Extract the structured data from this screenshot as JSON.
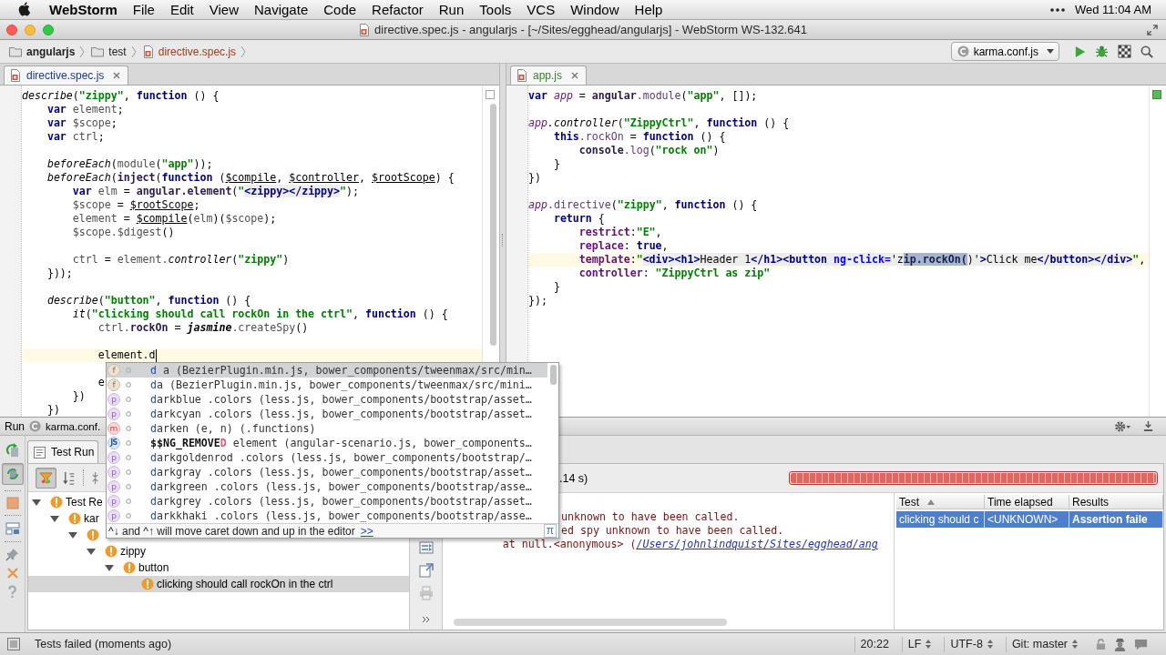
{
  "menubar": {
    "app": "WebStorm",
    "menus": [
      "File",
      "Edit",
      "View",
      "Navigate",
      "Code",
      "Refactor",
      "Run",
      "Tools",
      "VCS",
      "Window",
      "Help"
    ],
    "clock": "Wed 11:04 AM"
  },
  "window": {
    "title": "directive.spec.js - angularjs - [~/Sites/egghead/angularjs] - WebStorm WS-132.641"
  },
  "navbar": {
    "crumbs": [
      {
        "kind": "project",
        "label": "angularjs"
      },
      {
        "kind": "folder",
        "label": "test"
      },
      {
        "kind": "file",
        "label": "directive.spec.js",
        "unversioned": true
      }
    ],
    "run_config": "karma.conf.js"
  },
  "editors": [
    {
      "tab": {
        "label": "directive.spec.js",
        "modified": true,
        "added": false,
        "selected": true
      },
      "inspection_passed": false,
      "lines": [
        {
          "current": false,
          "tokens": [
            {
              "text": "describe",
              "kind": "call"
            },
            {
              "text": "(",
              "kind": "plain"
            },
            {
              "text": "\"zippy\"",
              "kind": "string"
            },
            {
              "text": ", ",
              "kind": "plain"
            },
            {
              "text": "function",
              "kind": "keyword"
            },
            {
              "text": " () {",
              "kind": "plain"
            }
          ],
          "children": [
            {
              "current": false,
              "tokens": [
                {
                  "text": "var",
                  "kind": "keyword"
                },
                {
                  "text": " element",
                  "kind": "local"
                },
                {
                  "text": ";",
                  "kind": "plain"
                }
              ]
            },
            {
              "current": false,
              "tokens": [
                {
                  "text": "var",
                  "kind": "keyword"
                },
                {
                  "text": " $scope",
                  "kind": "local"
                },
                {
                  "text": ";",
                  "kind": "plain"
                }
              ]
            },
            {
              "current": false,
              "tokens": [
                {
                  "text": "var",
                  "kind": "keyword"
                },
                {
                  "text": " ctrl",
                  "kind": "local"
                },
                {
                  "text": ";",
                  "kind": "plain"
                }
              ]
            },
            {
              "current": false
            },
            {
              "current": false,
              "tokens": [
                {
                  "text": "beforeEach",
                  "kind": "call"
                },
                {
                  "text": "(",
                  "kind": "plain"
                },
                {
                  "text": "module",
                  "kind": "local"
                },
                {
                  "text": "(",
                  "kind": "plain"
                },
                {
                  "text": "\"app\"",
                  "kind": "string"
                },
                {
                  "text": "));",
                  "kind": "plain"
                }
              ]
            },
            {
              "current": false,
              "tokens": [
                {
                  "text": "beforeEach",
                  "kind": "call"
                },
                {
                  "text": "(",
                  "kind": "plain"
                },
                {
                  "text": "inject",
                  "kind": "global"
                },
                {
                  "text": "(",
                  "kind": "plain"
                },
                {
                  "text": "function",
                  "kind": "keyword"
                },
                {
                  "text": " (",
                  "kind": "plain"
                },
                {
                  "text": "$compile",
                  "kind": "param"
                },
                {
                  "text": ", ",
                  "kind": "plain"
                },
                {
                  "text": "$controller",
                  "kind": "param"
                },
                {
                  "text": ", ",
                  "kind": "plain"
                },
                {
                  "text": "$rootScope",
                  "kind": "param"
                },
                {
                  "text": ") {",
                  "kind": "plain"
                }
              ],
              "children": [
                {
                  "current": false,
                  "tokens": [
                    {
                      "text": "var",
                      "kind": "keyword"
                    },
                    {
                      "text": " elm",
                      "kind": "local"
                    },
                    {
                      "text": " = ",
                      "kind": "plain"
                    },
                    {
                      "text": "angular.element",
                      "kind": "global"
                    },
                    {
                      "text": "(",
                      "kind": "plain"
                    },
                    {
                      "text": "\"",
                      "kind": "string"
                    },
                    {
                      "text": "<zippy></zippy>",
                      "kind": "tag"
                    },
                    {
                      "text": "\"",
                      "kind": "string"
                    },
                    {
                      "text": ");",
                      "kind": "plain"
                    }
                  ]
                },
                {
                  "current": false,
                  "tokens": [
                    {
                      "text": "$scope",
                      "kind": "local"
                    },
                    {
                      "text": " = ",
                      "kind": "plain"
                    },
                    {
                      "text": "$rootScope",
                      "kind": "param"
                    },
                    {
                      "text": ";",
                      "kind": "plain"
                    }
                  ]
                },
                {
                  "current": false,
                  "tokens": [
                    {
                      "text": "element",
                      "kind": "local"
                    },
                    {
                      "text": " = ",
                      "kind": "plain"
                    },
                    {
                      "text": "$compile",
                      "kind": "param"
                    },
                    {
                      "text": "(",
                      "kind": "plain"
                    },
                    {
                      "text": "elm",
                      "kind": "local"
                    },
                    {
                      "text": ")(",
                      "kind": "plain"
                    },
                    {
                      "text": "$scope",
                      "kind": "local"
                    },
                    {
                      "text": ");",
                      "kind": "plain"
                    }
                  ]
                },
                {
                  "current": false,
                  "tokens": [
                    {
                      "text": "$scope.$digest",
                      "kind": "local"
                    },
                    {
                      "text": "()",
                      "kind": "plain"
                    }
                  ]
                },
                {
                  "current": false
                },
                {
                  "current": false,
                  "tokens": [
                    {
                      "text": "ctrl",
                      "kind": "local"
                    },
                    {
                      "text": " = ",
                      "kind": "plain"
                    },
                    {
                      "text": "element.",
                      "kind": "local"
                    },
                    {
                      "text": "controller",
                      "kind": "call"
                    },
                    {
                      "text": "(",
                      "kind": "plain"
                    },
                    {
                      "text": "\"zippy\"",
                      "kind": "string"
                    },
                    {
                      "text": ")",
                      "kind": "plain"
                    }
                  ]
                }
              ]
            },
            {
              "current": false,
              "tokens": [
                {
                  "text": "}));",
                  "kind": "plain"
                }
              ]
            },
            {
              "current": false
            },
            {
              "current": false,
              "tokens": [
                {
                  "text": "describe",
                  "kind": "call"
                },
                {
                  "text": "(",
                  "kind": "plain"
                },
                {
                  "text": "\"button\"",
                  "kind": "string"
                },
                {
                  "text": ", ",
                  "kind": "plain"
                },
                {
                  "text": "function",
                  "kind": "keyword"
                },
                {
                  "text": " () {",
                  "kind": "plain"
                }
              ],
              "children": [
                {
                  "current": false,
                  "tokens": [
                    {
                      "text": "it",
                      "kind": "call"
                    },
                    {
                      "text": "(",
                      "kind": "plain"
                    },
                    {
                      "text": "\"clicking should call rockOn in the ctrl\"",
                      "kind": "string"
                    },
                    {
                      "text": ", ",
                      "kind": "plain"
                    },
                    {
                      "text": "function",
                      "kind": "keyword"
                    },
                    {
                      "text": " () {",
                      "kind": "plain"
                    }
                  ],
                  "children": [
                    {
                      "current": false,
                      "tokens": [
                        {
                          "text": "ctrl.",
                          "kind": "local"
                        },
                        {
                          "text": "rockOn",
                          "kind": "global"
                        },
                        {
                          "text": " = ",
                          "kind": "plain"
                        },
                        {
                          "text": "jasmine",
                          "kind": "static"
                        },
                        {
                          "text": ".createSpy",
                          "kind": "local"
                        },
                        {
                          "text": "()",
                          "kind": "plain"
                        }
                      ]
                    },
                    {
                      "current": false
                    },
                    {
                      "current": true,
                      "caret": true,
                      "tokens": [
                        {
                          "text": "element.d",
                          "kind": "plain"
                        }
                      ]
                    },
                    {
                      "current": false
                    },
                    {
                      "current": false,
                      "tokens": [
                        {
                          "text": "e",
                          "kind": "plain"
                        }
                      ]
                    }
                  ]
                },
                {
                  "current": false,
                  "tokens": [
                    {
                      "text": "})",
                      "kind": "plain"
                    }
                  ]
                }
              ]
            },
            {
              "current": false,
              "tokens": [
                {
                  "text": "})",
                  "kind": "plain"
                }
              ]
            }
          ]
        }
      ]
    },
    {
      "tab": {
        "label": "app.js",
        "modified": false,
        "added": true,
        "selected": true
      },
      "inspection_passed": true,
      "lines": [
        {
          "current": false,
          "tokens": [
            {
              "text": "var",
              "kind": "keyword"
            },
            {
              "text": " app",
              "kind": "variable"
            },
            {
              "text": " = ",
              "kind": "plain"
            },
            {
              "text": "angular",
              "kind": "global"
            },
            {
              "text": ".module",
              "kind": "member"
            },
            {
              "text": "(",
              "kind": "plain"
            },
            {
              "text": "\"app\"",
              "kind": "string"
            },
            {
              "text": ", []);",
              "kind": "plain"
            }
          ]
        },
        {
          "current": false
        },
        {
          "current": false,
          "tokens": [
            {
              "text": "app",
              "kind": "variable"
            },
            {
              "text": ".controller",
              "kind": "call"
            },
            {
              "text": "(",
              "kind": "plain"
            },
            {
              "text": "\"ZippyCtrl\"",
              "kind": "string"
            },
            {
              "text": ", ",
              "kind": "plain"
            },
            {
              "text": "function",
              "kind": "keyword"
            },
            {
              "text": " () {",
              "kind": "plain"
            }
          ],
          "children": [
            {
              "current": false,
              "tokens": [
                {
                  "text": "this",
                  "kind": "keyword"
                },
                {
                  "text": ".rockOn",
                  "kind": "member"
                },
                {
                  "text": " = ",
                  "kind": "plain"
                },
                {
                  "text": "function",
                  "kind": "keyword"
                },
                {
                  "text": " () {",
                  "kind": "plain"
                }
              ],
              "children": [
                {
                  "current": false,
                  "tokens": [
                    {
                      "text": "console",
                      "kind": "global"
                    },
                    {
                      "text": ".log",
                      "kind": "member"
                    },
                    {
                      "text": "(",
                      "kind": "plain"
                    },
                    {
                      "text": "\"rock on\"",
                      "kind": "string"
                    },
                    {
                      "text": ")",
                      "kind": "plain"
                    }
                  ]
                }
              ]
            },
            {
              "current": false,
              "tokens": [
                {
                  "text": "}",
                  "kind": "plain"
                }
              ]
            }
          ]
        },
        {
          "current": false,
          "tokens": [
            {
              "text": "})",
              "kind": "plain"
            }
          ]
        },
        {
          "current": false
        },
        {
          "current": false,
          "tokens": [
            {
              "text": "app",
              "kind": "variable"
            },
            {
              "text": ".directive",
              "kind": "member"
            },
            {
              "text": "(",
              "kind": "plain"
            },
            {
              "text": "\"zippy\"",
              "kind": "string"
            },
            {
              "text": ", ",
              "kind": "plain"
            },
            {
              "text": "function",
              "kind": "keyword"
            },
            {
              "text": " () {",
              "kind": "plain"
            }
          ],
          "children": [
            {
              "current": false,
              "tokens": [
                {
                  "text": "return",
                  "kind": "keyword"
                },
                {
                  "text": " {",
                  "kind": "plain"
                }
              ],
              "children": [
                {
                  "current": false,
                  "tokens": [
                    {
                      "text": "restrict",
                      "kind": "field"
                    },
                    {
                      "text": ":",
                      "kind": "plain"
                    },
                    {
                      "text": "\"E\"",
                      "kind": "string"
                    },
                    {
                      "text": ",",
                      "kind": "plain"
                    }
                  ]
                },
                {
                  "current": false,
                  "tokens": [
                    {
                      "text": "replace",
                      "kind": "field"
                    },
                    {
                      "text": ": ",
                      "kind": "plain"
                    },
                    {
                      "text": "true",
                      "kind": "keyword"
                    },
                    {
                      "text": ",",
                      "kind": "plain"
                    }
                  ]
                },
                {
                  "current": true,
                  "tokens": [
                    {
                      "text": "template",
                      "kind": "field"
                    },
                    {
                      "text": ":",
                      "kind": "plain"
                    },
                    {
                      "text": "\"",
                      "kind": "string"
                    },
                    {
                      "text": "<div><h1>",
                      "kind": "tag"
                    },
                    {
                      "text": "Header 1",
                      "kind": "html"
                    },
                    {
                      "text": "</h1><button ",
                      "kind": "tag"
                    },
                    {
                      "text": "ng-click=",
                      "kind": "attr"
                    },
                    {
                      "text": "'z",
                      "kind": "html"
                    },
                    {
                      "text": "ip.rockOn(",
                      "kind": "selection"
                    },
                    {
                      "text": ")'",
                      "kind": "html"
                    },
                    {
                      "text": ">",
                      "kind": "tag"
                    },
                    {
                      "text": "Click me",
                      "kind": "html"
                    },
                    {
                      "text": "</button></div>",
                      "kind": "tag"
                    },
                    {
                      "text": "\"",
                      "kind": "string"
                    },
                    {
                      "text": ",",
                      "kind": "plain"
                    }
                  ]
                },
                {
                  "current": false,
                  "tokens": [
                    {
                      "text": "controller",
                      "kind": "field"
                    },
                    {
                      "text": ": ",
                      "kind": "plain"
                    },
                    {
                      "text": "\"ZippyCtrl as zip\"",
                      "kind": "string"
                    }
                  ]
                }
              ]
            },
            {
              "current": false,
              "tokens": [
                {
                  "text": "}",
                  "kind": "plain"
                }
              ]
            }
          ]
        },
        {
          "current": false,
          "tokens": [
            {
              "text": "});",
              "kind": "plain"
            }
          ]
        }
      ]
    }
  ],
  "completion": {
    "items": [
      {
        "kind": "function",
        "badge": "f",
        "selected": true,
        "parts": [
          {
            "text": "d",
            "kind": "match"
          },
          {
            "text": " a (BezierPlugin.min.js, bower_components/tweenmax/src/min…",
            "kind": "plain"
          }
        ]
      },
      {
        "kind": "function",
        "badge": "f",
        "selected": false,
        "parts": [
          {
            "text": "d",
            "kind": "match"
          },
          {
            "text": "a (BezierPlugin.min.js, bower_components/tweenmax/src/mini…",
            "kind": "plain"
          }
        ]
      },
      {
        "kind": "property",
        "badge": "p",
        "selected": false,
        "parts": [
          {
            "text": "d",
            "kind": "match"
          },
          {
            "text": "arkblue .colors (less.js, bower_components/bootstrap/asset…",
            "kind": "plain"
          }
        ]
      },
      {
        "kind": "property",
        "badge": "p",
        "selected": false,
        "parts": [
          {
            "text": "d",
            "kind": "match"
          },
          {
            "text": "arkcyan .colors (less.js, bower_components/bootstrap/asset…",
            "kind": "plain"
          }
        ]
      },
      {
        "kind": "method",
        "badge": "m",
        "selected": false,
        "parts": [
          {
            "text": "d",
            "kind": "match"
          },
          {
            "text": "arken (e, n) (.functions)",
            "kind": "plain"
          }
        ]
      },
      {
        "kind": "script",
        "badge": "JS",
        "selected": false,
        "parts": [
          {
            "text": "$$NG_REMOVE",
            "kind": "bold"
          },
          {
            "text": "D",
            "kind": "match_bold"
          },
          {
            "text": " element (angular-scenario.js, bower_components…",
            "kind": "plain"
          }
        ]
      },
      {
        "kind": "property",
        "badge": "p",
        "selected": false,
        "parts": [
          {
            "text": "d",
            "kind": "match"
          },
          {
            "text": "arkgoldenrod .colors (less.js, bower_components/bootstrap/…",
            "kind": "plain"
          }
        ]
      },
      {
        "kind": "property",
        "badge": "p",
        "selected": false,
        "parts": [
          {
            "text": "d",
            "kind": "match"
          },
          {
            "text": "arkgray .colors (less.js, bower_components/bootstrap/asset…",
            "kind": "plain"
          }
        ]
      },
      {
        "kind": "property",
        "badge": "p",
        "selected": false,
        "parts": [
          {
            "text": "d",
            "kind": "match"
          },
          {
            "text": "arkgreen .colors (less.js, bower_components/bootstrap/asse…",
            "kind": "plain"
          }
        ]
      },
      {
        "kind": "property",
        "badge": "p",
        "selected": false,
        "parts": [
          {
            "text": "d",
            "kind": "match"
          },
          {
            "text": "arkgrey .colors (less.js, bower_components/bootstrap/asset…",
            "kind": "plain"
          }
        ]
      },
      {
        "kind": "property",
        "badge": "p",
        "selected": false,
        "parts": [
          {
            "text": "d",
            "kind": "match"
          },
          {
            "text": "arkkhaki .colors (less.js, bower_components/bootstrap/asse…",
            "kind": "plain"
          }
        ]
      }
    ],
    "footer": {
      "hint": "^↓ and ^↑ will move caret down and up in the editor",
      "link": ">>",
      "button": "π"
    }
  },
  "run_panel": {
    "title": "Run",
    "config": "karma.conf.",
    "auto_test": true,
    "hide_passed": true,
    "tab": {
      "label": "Test Run",
      "selected": true
    },
    "tree": [
      {
        "label": "Test Re",
        "failed": true,
        "expanded": true,
        "selected": false,
        "children": [
          {
            "label": "kar",
            "failed": true,
            "expanded": true,
            "selected": false,
            "children": [
              {
                "failed": true,
                "expanded": true,
                "selected": false,
                "children": [
                  {
                    "label": "zippy",
                    "failed": true,
                    "expanded": true,
                    "selected": false,
                    "children": [
                      {
                        "label": "button",
                        "failed": true,
                        "expanded": true,
                        "selected": false,
                        "children": [
                          {
                            "label": "clicking should call rockOn in the ctrl",
                            "failed": true,
                            "selected": true
                          }
                        ]
                      }
                    ]
                  }
                ]
              }
            ]
          }
        ]
      }
    ],
    "summary": ".14 s)",
    "progress": {
      "level": 1,
      "failed": true
    },
    "console": [
      {
        "hidden_start": true,
        "text": "unknown to have been called."
      },
      {
        "hidden_start": true,
        "text": "ed spy unknown to have been called.",
        "children": [
          {
            "hidden_start": false,
            "text": "at null.<anonymous> (",
            "link": "/Users/johnlindquist/Sites/egghead/ang"
          }
        ]
      }
    ],
    "results": {
      "columns": [
        {
          "label": "Test",
          "sorted": true
        },
        {
          "label": "Time elapsed",
          "sorted": false
        },
        {
          "label": "Results",
          "sorted": false
        }
      ],
      "rows": [
        {
          "selected": true,
          "cells": [
            "clicking should c",
            "<UNKNOWN>",
            "Assertion faile"
          ]
        }
      ]
    }
  },
  "status_bar": {
    "message": "Tests failed (moments ago)",
    "caret_position": "20:22",
    "line_separator": "LF",
    "encoding": "UTF-8",
    "vcs_branch": "Git: master"
  }
}
